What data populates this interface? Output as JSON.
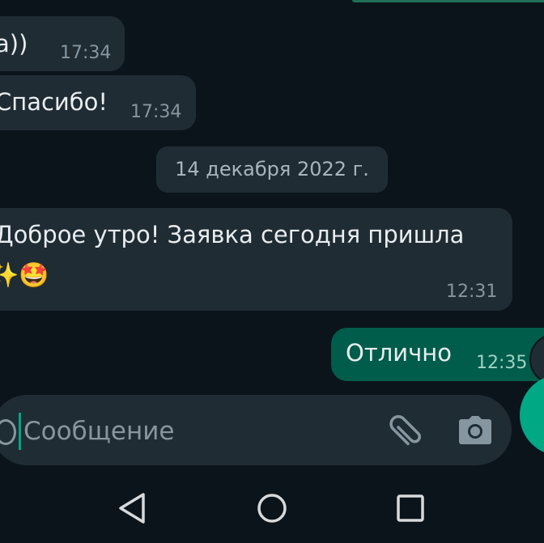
{
  "messages": [
    {
      "text": "а))",
      "time": "17:34",
      "direction": "incoming"
    },
    {
      "text": "Спасибо!",
      "time": "17:34",
      "direction": "incoming"
    },
    {
      "text_line1": "Доброе утро! Заявка сегодня пришла",
      "emoji": "✨🤩",
      "time": "12:31",
      "direction": "incoming"
    },
    {
      "text": "Отлично",
      "time": "12:35",
      "direction": "outgoing"
    }
  ],
  "date_divider": "14 декабря 2022 г.",
  "composer": {
    "placeholder": "Сообщение",
    "icons": [
      "emoji-icon",
      "paperclip-icon",
      "camera-icon",
      "mic-icon"
    ]
  },
  "navbar": {
    "icons": [
      "back-triangle-icon",
      "home-circle-icon",
      "recents-square-icon"
    ]
  },
  "colors": {
    "background": "#0b141a",
    "incoming_bubble": "#1f2c34",
    "outgoing_bubble": "#005c4b",
    "accent": "#00a884"
  }
}
